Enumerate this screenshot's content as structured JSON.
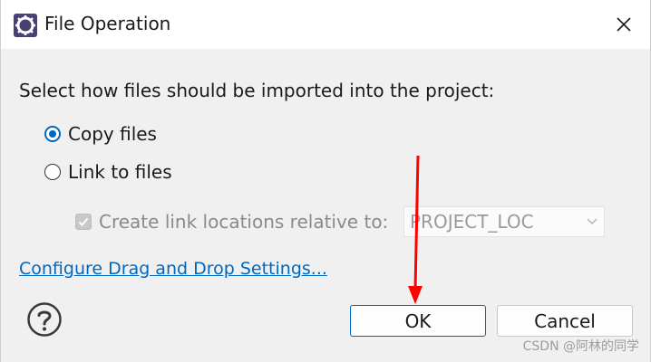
{
  "window": {
    "title": "File Operation",
    "app_icon": "eclipse-icon",
    "close_icon": "close-icon"
  },
  "dialog": {
    "prompt": "Select how files should be imported into the project:",
    "options": [
      {
        "label": "Copy files",
        "checked": true
      },
      {
        "label": "Link to files",
        "checked": false
      }
    ],
    "relative_checkbox": {
      "label": "Create link locations relative to:",
      "checked": true,
      "disabled": true
    },
    "relative_combo": {
      "value": "PROJECT_LOC",
      "disabled": true
    },
    "settings_link": "Configure Drag and Drop Settings...",
    "help_icon": "help-icon"
  },
  "buttons": {
    "ok": "OK",
    "cancel": "Cancel"
  },
  "annotation": {
    "color": "#ff0000",
    "watermark": "CSDN @阿林的同学"
  },
  "colors": {
    "accent": "#0067c0",
    "disabled_text": "#8a8a8a"
  }
}
